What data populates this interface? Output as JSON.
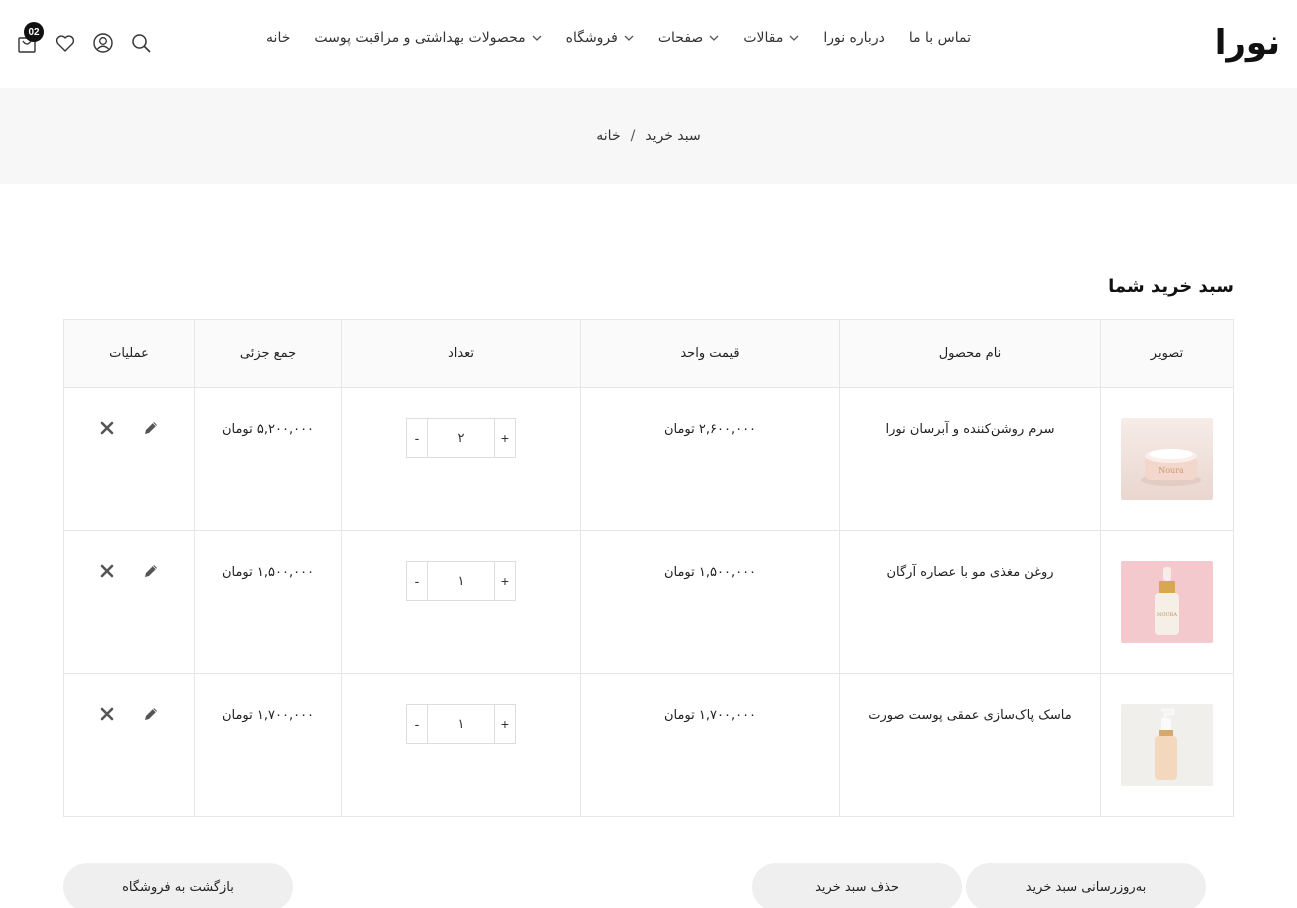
{
  "header": {
    "logo": "نورا",
    "cart_badge": "02",
    "nav": [
      {
        "label": "خانه",
        "dropdown": false
      },
      {
        "label": "محصولات بهداشتی و مراقبت پوست",
        "dropdown": true
      },
      {
        "label": "فروشگاه",
        "dropdown": true
      },
      {
        "label": "صفحات",
        "dropdown": true
      },
      {
        "label": "مقالات",
        "dropdown": true
      },
      {
        "label": "درباره نورا",
        "dropdown": false
      },
      {
        "label": "تماس با ما",
        "dropdown": false
      }
    ],
    "icons": [
      "search-icon",
      "user-icon",
      "heart-icon",
      "shopping-bag-icon"
    ]
  },
  "breadcrumb": {
    "home": "خانه",
    "separator": "/",
    "current": "سبد خرید"
  },
  "cart": {
    "title": "سبد خرید شما",
    "columns": [
      "تصویر",
      "نام محصول",
      "قیمت واحد",
      "تعداد",
      "جمع جزئی",
      "عملیات"
    ],
    "rows": [
      {
        "name": "سرم روشن‌کننده و آبرسان نورا",
        "price": "۲,۶۰۰,۰۰۰ تومان",
        "qty": "۲",
        "subtotal": "۵,۲۰۰,۰۰۰ تومان",
        "thumb": "cream-jar"
      },
      {
        "name": "روغن مغذی مو با عصاره آرگان",
        "price": "۱,۵۰۰,۰۰۰ تومان",
        "qty": "۱",
        "subtotal": "۱,۵۰۰,۰۰۰ تومان",
        "thumb": "dropper-bottle"
      },
      {
        "name": "ماسک پاک‌سازی عمقی پوست صورت",
        "price": "۱,۷۰۰,۰۰۰ تومان",
        "qty": "۱",
        "subtotal": "۱,۷۰۰,۰۰۰ تومان",
        "thumb": "pump-bottle"
      }
    ],
    "qty_minus": "-",
    "qty_plus": "+"
  },
  "buttons": {
    "update": "به‌روزرسانی سبد خرید",
    "clear": "حذف سبد خرید",
    "back": "بازگشت به فروشگاه"
  },
  "colors": {
    "accent": "#111111",
    "band": "#f7f7f7",
    "button_bg": "#efefef",
    "border": "#e6e6e6"
  }
}
